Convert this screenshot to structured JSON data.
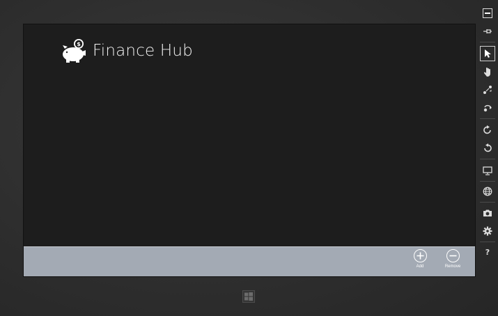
{
  "app": {
    "title": "Finance Hub",
    "logo_icon": "piggy-bank-icon"
  },
  "app_bar": {
    "background": "#a3aab4",
    "commands": [
      {
        "label": "Add",
        "icon": "plus-circle-icon"
      },
      {
        "label": "Remove",
        "icon": "minus-circle-icon"
      }
    ]
  },
  "simulator_toolbar": {
    "buttons": [
      {
        "icon": "minimize-icon"
      },
      {
        "icon": "pin-icon"
      },
      {
        "icon": "mouse-pointer-icon",
        "active": true
      },
      {
        "icon": "touch-hand-icon"
      },
      {
        "icon": "pinch-zoom-icon"
      },
      {
        "icon": "rotate-touch-icon"
      },
      {
        "icon": "rotate-clockwise-icon"
      },
      {
        "icon": "rotate-counterclockwise-icon"
      },
      {
        "icon": "change-resolution-icon"
      },
      {
        "icon": "set-location-icon"
      },
      {
        "icon": "screenshot-icon"
      },
      {
        "icon": "settings-icon"
      },
      {
        "icon": "help-icon"
      }
    ]
  },
  "windows_button_icon": "windows-logo-icon",
  "colors": {
    "screen_background": "#1d1d1d",
    "device_frame": "#2e2e2e",
    "title_text": "#f2f2f2"
  }
}
